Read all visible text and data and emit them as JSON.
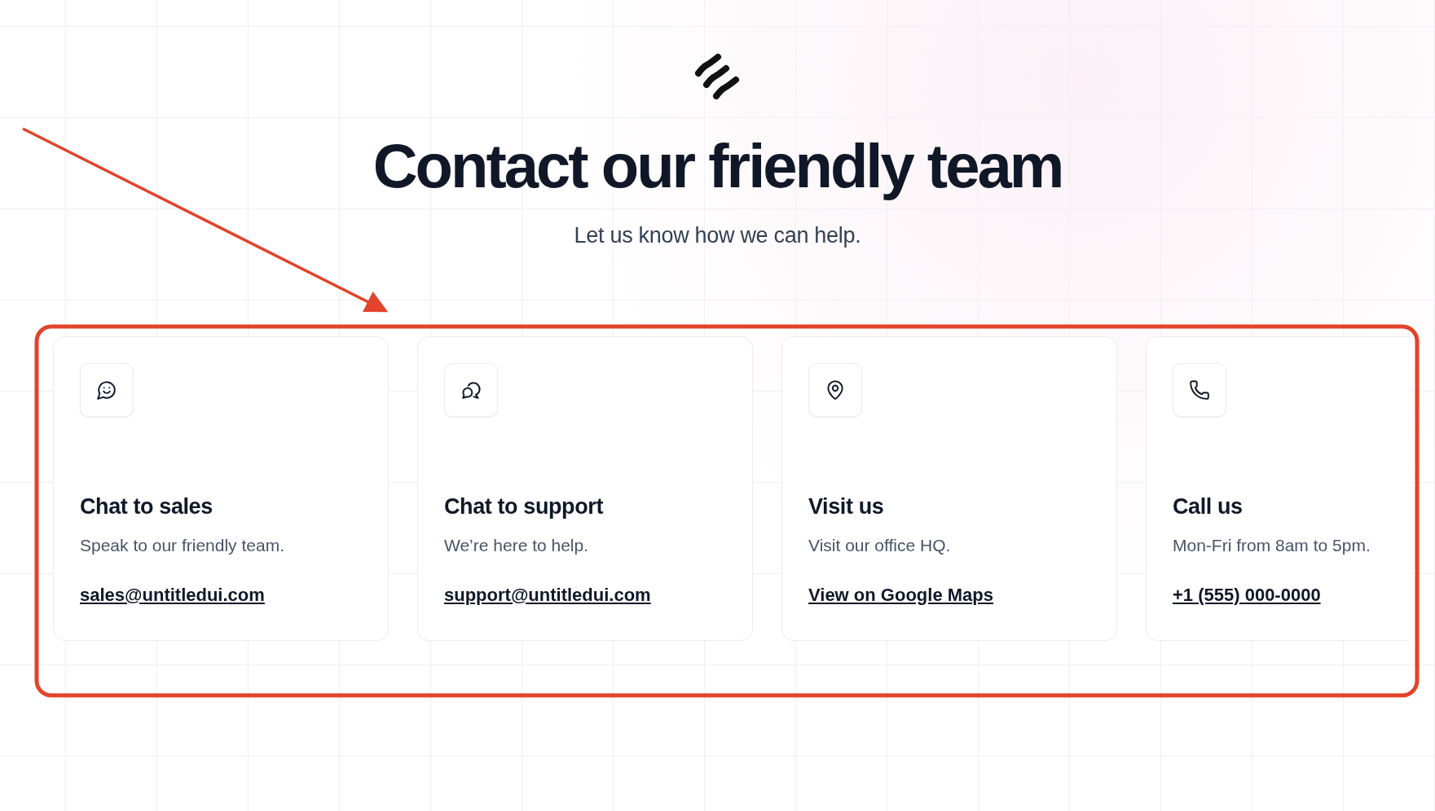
{
  "header": {
    "title": "Contact our friendly team",
    "subtitle": "Let us know how we can help."
  },
  "cards": [
    {
      "kind": "sales",
      "title": "Chat to sales",
      "description": "Speak to our friendly team.",
      "link": "sales@untitledui.com"
    },
    {
      "kind": "support",
      "title": "Chat to support",
      "description": "We’re here to help.",
      "link": "support@untitledui.com"
    },
    {
      "kind": "visit",
      "title": "Visit us",
      "description": "Visit our office HQ.",
      "link": "View on Google Maps"
    },
    {
      "kind": "call",
      "title": "Call us",
      "description": "Mon-Fri from 8am to 5pm.",
      "link": "+1 (555) 000-0000"
    }
  ]
}
